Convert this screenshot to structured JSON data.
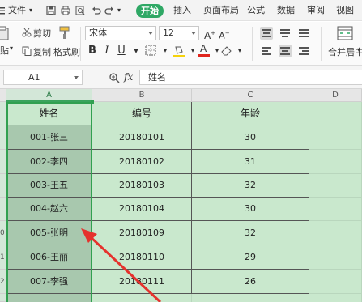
{
  "menubar": {
    "file_label": "文件",
    "tabs": [
      "开始",
      "插入",
      "页面布局",
      "公式",
      "数据",
      "审阅",
      "视图"
    ]
  },
  "ribbon": {
    "cut_label": "剪切",
    "copy_label": "复制",
    "paste_label": "贴",
    "format_painter_label": "格式刷",
    "font_name": "宋体",
    "font_size": "12",
    "merge_label": "合并居中"
  },
  "formula_bar": {
    "name_box": "A1",
    "fx_label": "fx",
    "content": "姓名"
  },
  "columns": [
    "A",
    "B",
    "C",
    "D"
  ],
  "row_header_labels": [
    "",
    "",
    "",
    "",
    "",
    "0",
    "1",
    "2",
    ""
  ],
  "table": {
    "headers": [
      "姓名",
      "编号",
      "年龄"
    ],
    "rows": [
      [
        "001-张三",
        "20180101",
        "30"
      ],
      [
        "002-李四",
        "20180102",
        "31"
      ],
      [
        "003-王五",
        "20180103",
        "32"
      ],
      [
        "004-赵六",
        "20180104",
        "30"
      ],
      [
        "005-张明",
        "20180109",
        "32"
      ],
      [
        "006-王丽",
        "20180110",
        "29"
      ],
      [
        "007-李强",
        "20180111",
        "26"
      ]
    ]
  },
  "colors": {
    "accent": "#2fa865",
    "cell_fill": "#c9e8cd",
    "selected_column_fill": "#a8c8ae",
    "annotation_arrow": "#e5322d"
  }
}
